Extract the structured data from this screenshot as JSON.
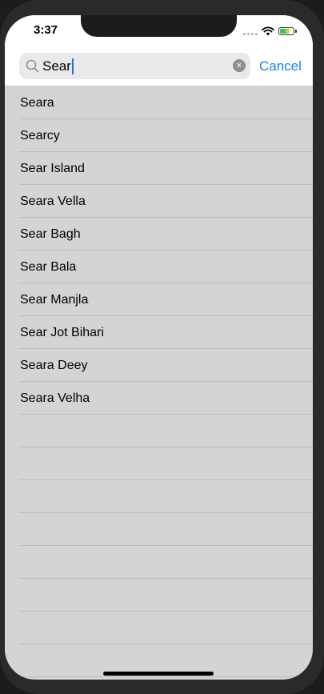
{
  "status_bar": {
    "time": "3:37"
  },
  "search": {
    "query": "Sear",
    "cancel_label": "Cancel",
    "clear_icon": "×"
  },
  "results": [
    "Seara",
    "Searcy",
    "Sear Island",
    "Seara Vella",
    "Sear Bagh",
    "Sear Bala",
    "Sear Manjla",
    "Sear Jot Bihari",
    "Seara Deey",
    "Seara Velha"
  ],
  "empty_row_count": 8,
  "colors": {
    "accent": "#1a82e6",
    "list_background": "#d4d4d4",
    "battery": "#34c759"
  },
  "icons": {
    "search": "magnifying-glass-icon",
    "clear": "clear-circle-icon",
    "wifi": "wifi-icon",
    "battery": "battery-charging-icon",
    "signal": "cellular-signal-icon"
  }
}
